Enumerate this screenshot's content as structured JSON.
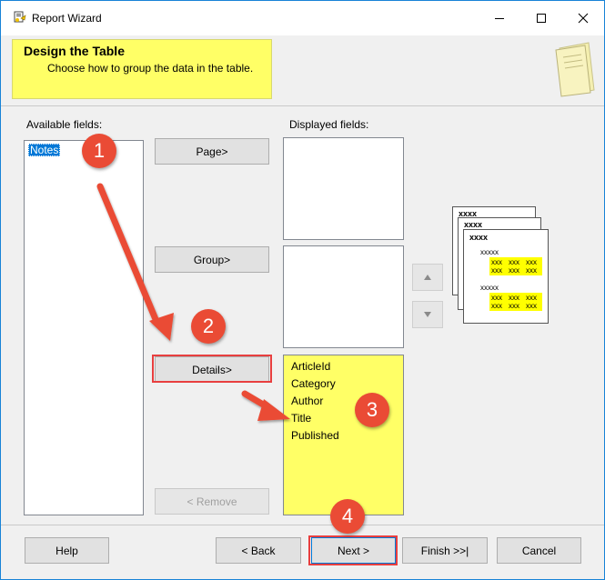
{
  "window": {
    "title": "Report Wizard",
    "minimize_icon": "minimize-icon",
    "maximize_icon": "maximize-icon",
    "close_icon": "close-icon"
  },
  "header": {
    "title": "Design the Table",
    "subtitle": "Choose how to group the data in the table."
  },
  "available": {
    "label": "Available fields:",
    "items": [
      "Notes"
    ]
  },
  "actions": {
    "page": "Page>",
    "group": "Group>",
    "details": "Details>",
    "remove": "< Remove"
  },
  "displayed": {
    "label": "Displayed fields:",
    "details_items": [
      "ArticleId",
      "Category",
      "Author",
      "Title",
      "Published"
    ]
  },
  "preview": {
    "header_text": "xxxx",
    "group_text": "xxxxx",
    "cell_text": "xxx"
  },
  "footer": {
    "help": "Help",
    "back": "< Back",
    "next": "Next >",
    "finish": "Finish >>|",
    "cancel": "Cancel"
  },
  "annotations": {
    "step1": "1",
    "step2": "2",
    "step3": "3",
    "step4": "4"
  },
  "colors": {
    "accent_window_border": "#1883d7",
    "banner_yellow": "#ffff66",
    "details_yellow": "#ffff66",
    "annotation_red": "#ea4b35",
    "selection_blue": "#0078d7"
  }
}
